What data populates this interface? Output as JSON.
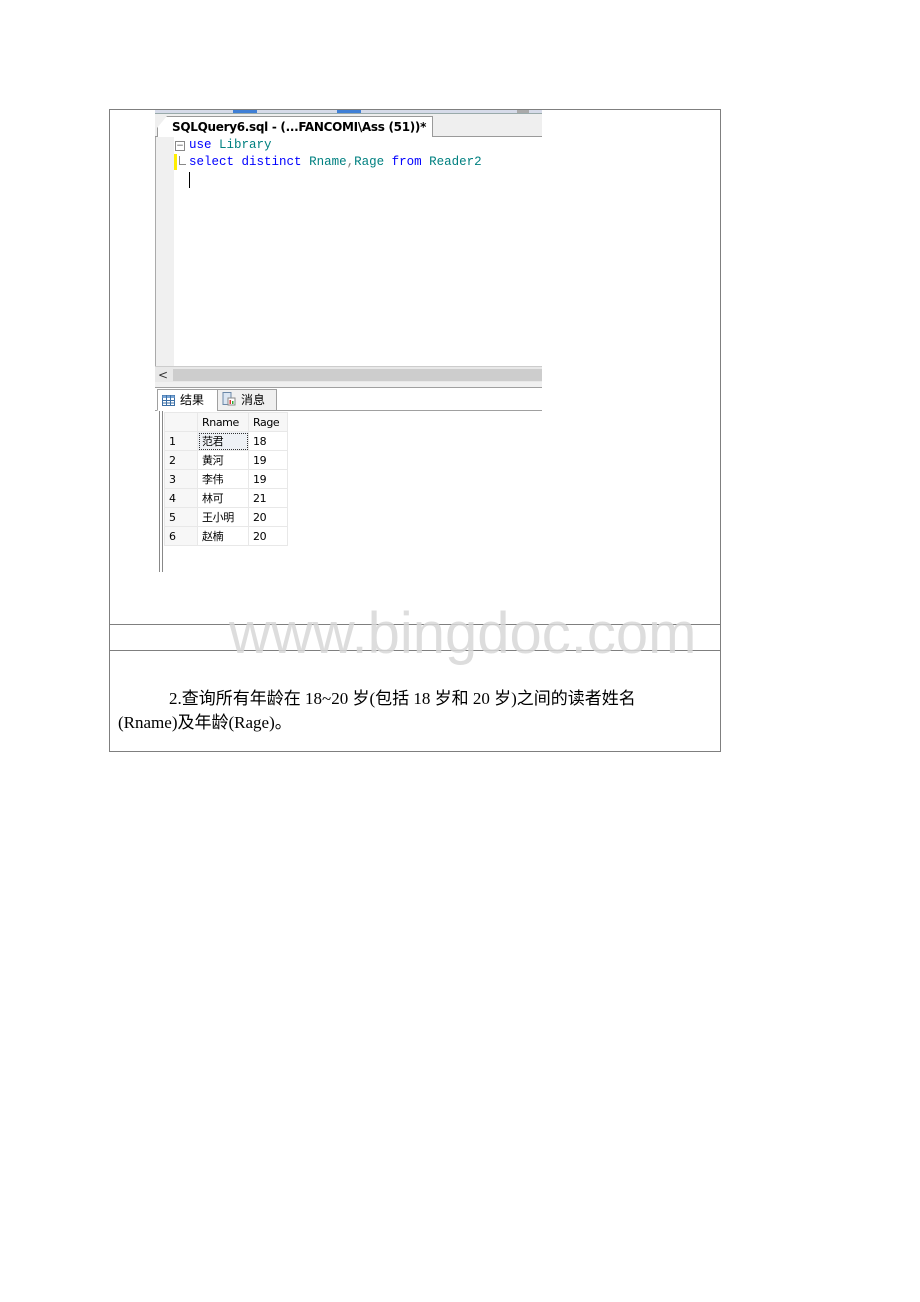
{
  "editor": {
    "tab_title": "SQLQuery6.sql - (...FANCOMI\\Ass (51))*",
    "code_lines": [
      {
        "tokens": [
          {
            "t": "use",
            "c": "kw"
          },
          {
            "t": " ",
            "c": "pl"
          },
          {
            "t": "Library",
            "c": "id"
          }
        ]
      },
      {
        "tokens": [
          {
            "t": "select",
            "c": "kw"
          },
          {
            "t": " ",
            "c": "pl"
          },
          {
            "t": "distinct",
            "c": "kw"
          },
          {
            "t": " ",
            "c": "pl"
          },
          {
            "t": "Rname",
            "c": "id"
          },
          {
            "t": ",",
            "c": "pl"
          },
          {
            "t": "Rage",
            "c": "id"
          },
          {
            "t": " ",
            "c": "pl"
          },
          {
            "t": "from",
            "c": "kw"
          },
          {
            "t": " ",
            "c": "pl"
          },
          {
            "t": "Reader2",
            "c": "id"
          }
        ]
      }
    ],
    "scroll_left_arrow": "<"
  },
  "results": {
    "tabs": [
      {
        "label": "结果",
        "icon": "grid-icon",
        "active": true
      },
      {
        "label": "消息",
        "icon": "messages-icon",
        "active": false
      }
    ],
    "columns": [
      "",
      "Rname",
      "Rage"
    ],
    "rows": [
      {
        "n": "1",
        "Rname": "范君",
        "Rage": "18"
      },
      {
        "n": "2",
        "Rname": "黄河",
        "Rage": "19"
      },
      {
        "n": "3",
        "Rname": "李伟",
        "Rage": "19"
      },
      {
        "n": "4",
        "Rname": "林可",
        "Rage": "21"
      },
      {
        "n": "5",
        "Rname": "王小明",
        "Rage": "20"
      },
      {
        "n": "6",
        "Rname": "赵楠",
        "Rage": "20"
      }
    ]
  },
  "document": {
    "question_line1": "2.查询所有年龄在 18~20 岁(包括 18 岁和 20 岁)之间的读者姓名",
    "question_line2": "(Rname)及年龄(Rage)。"
  },
  "watermark": "www.bingdoc.com"
}
